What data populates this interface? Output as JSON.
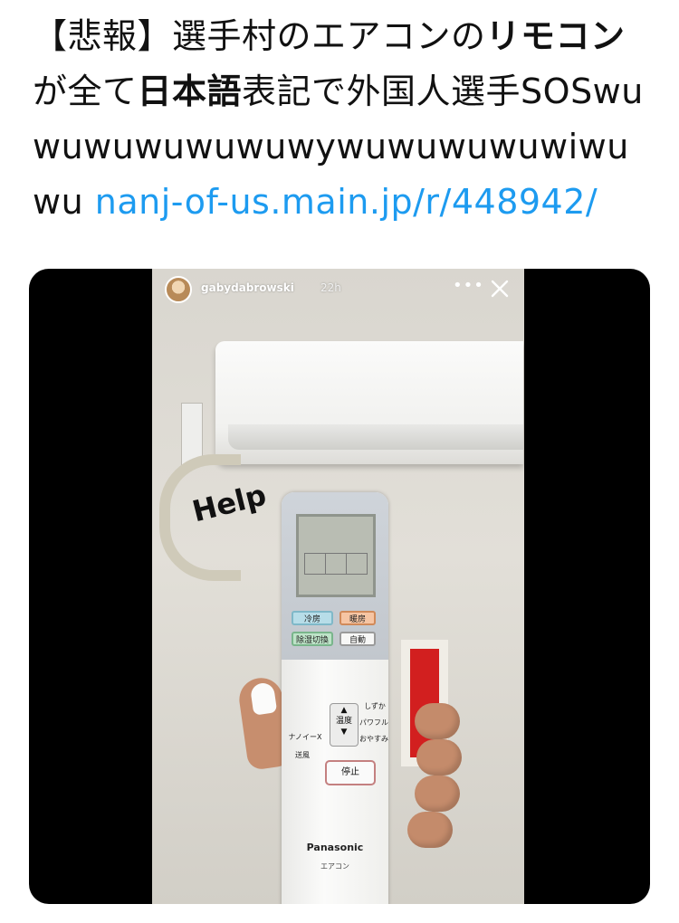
{
  "tweet": {
    "seg1": "【悲報】選手村のエアコンの",
    "seg2": "リモコン",
    "seg3": "が全て",
    "seg4": "日本語",
    "seg5": "表記で外国人選手SOSwuwuwuwuwuwuwywuwuwuwuwiwuwu",
    "link": "nanj-of-us.main.jp/r/448942/"
  },
  "story": {
    "username": "gabydabrowski",
    "timestamp": "22h",
    "more_icon": "more-dots-icon",
    "close_icon": "close-icon",
    "sticker_text": "Help"
  },
  "remote": {
    "cool": "冷房",
    "heat": "暖房",
    "dry": "除湿切換",
    "auto": "自動",
    "temp": "温度",
    "quiet": "しずか",
    "powerful": "パワフル",
    "timer": "おやすみ",
    "nanoe": "ナノイーX",
    "fan": "送風",
    "stop": "停止",
    "brand": "Panasonic",
    "model": "エアコン"
  },
  "colors": {
    "link": "#1d9bf0",
    "media_bg": "#000000"
  }
}
